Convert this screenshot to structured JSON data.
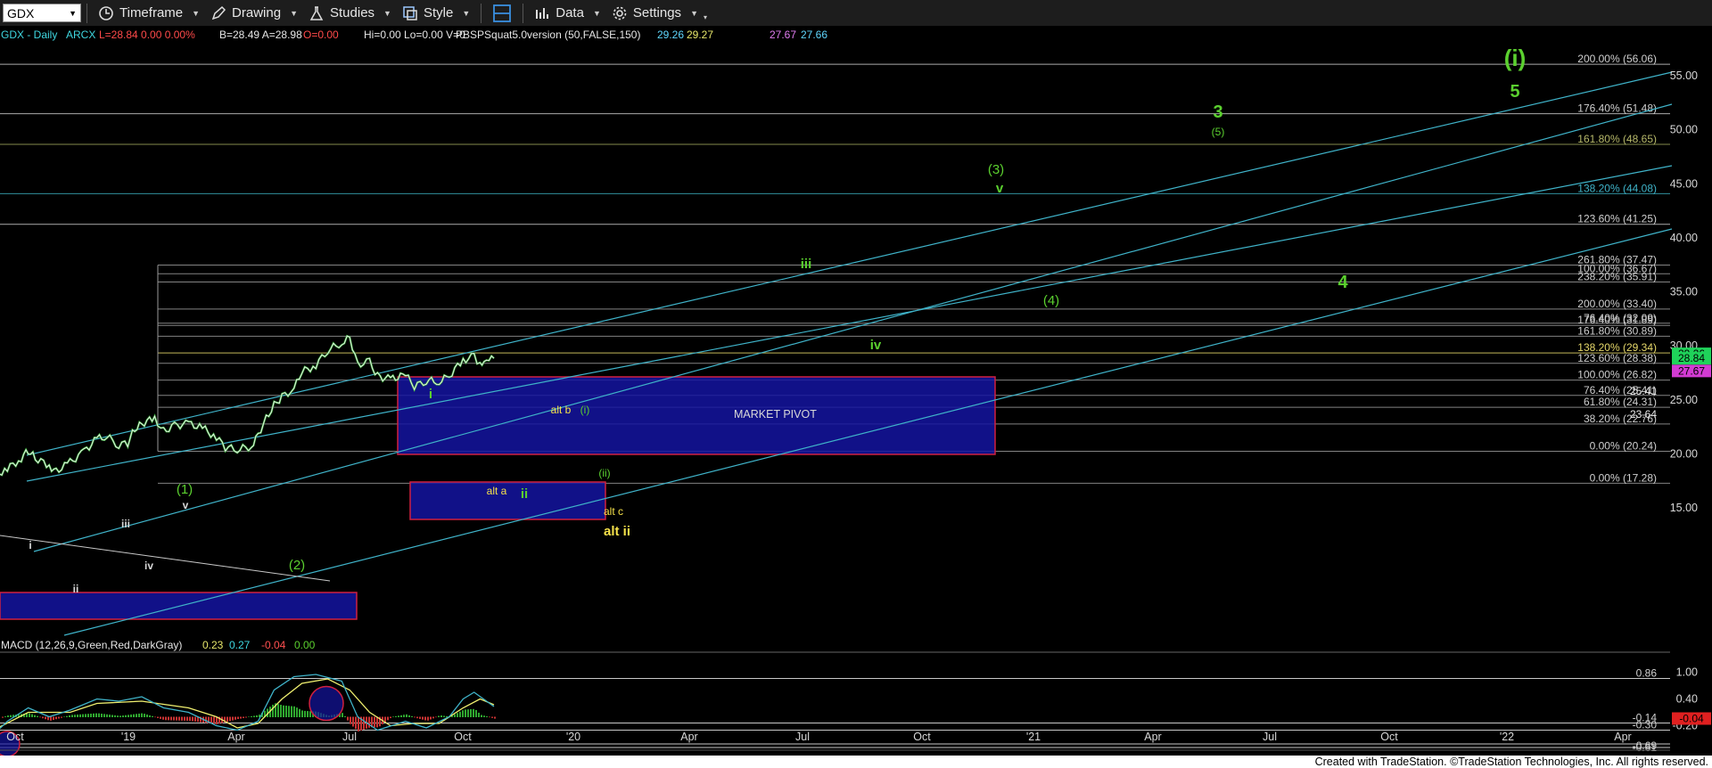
{
  "toolbar": {
    "symbol": "GDX",
    "timeframe": "Timeframe",
    "drawing": "Drawing",
    "studies": "Studies",
    "style": "Style",
    "data": "Data",
    "settings": "Settings"
  },
  "header": {
    "symbol": "GDX - Daily",
    "exchange": "ARCX",
    "quote": "L=28.84 0.00 0.00%",
    "bid_ask": "B=28.49 A=28.98",
    "ohl": "O=0.00",
    "hi": "Hi=0.00 Lo=0.00 V=0",
    "study": "PBSPSquat5.0version (50,FALSE,150)",
    "study_values": [
      "29.26",
      "29.27",
      "27.67",
      "27.66"
    ],
    "study_colors": [
      "#5fd7ff",
      "#e6e66a",
      "#e07cf0",
      "#5fd7ff"
    ]
  },
  "footer": {
    "text": "Created with TradeStation. ©TradeStation Technologies, Inc. All rights reserved."
  },
  "colors": {
    "green_label": "#5bd02f",
    "yellow_label": "#f5e14a",
    "channel": "#3fb3c9",
    "box_fill": "#1414a0",
    "box_border": "#d02040",
    "price_up": "#e8e8e8",
    "price_down": "#3ab43a",
    "macd_line": "#3fb3c9",
    "macd_signal": "#f0f070"
  },
  "chart_data": {
    "type": "line",
    "title": "GDX - Daily",
    "y_axis": {
      "ticks": [
        "55.00",
        "50.00",
        "45.00",
        "40.00",
        "35.00",
        "30.00",
        "25.00",
        "20.00",
        "15.00"
      ],
      "range": [
        13.5,
        60
      ]
    },
    "x_axis": {
      "ticks": [
        "Oct",
        "'19",
        "Apr",
        "Jul",
        "Oct",
        "'20",
        "Apr",
        "Jul",
        "Oct",
        "'21",
        "Apr",
        "Jul",
        "Oct",
        "'22",
        "Apr"
      ]
    },
    "fib_levels": [
      {
        "label": "200.00% (56.06)",
        "value": 56.06
      },
      {
        "label": "176.40% (51.48)",
        "value": 51.48
      },
      {
        "label": "161.80% (48.65)",
        "value": 48.65
      },
      {
        "label": "138.20% (44.08)",
        "value": 44.08
      },
      {
        "label": "123.60% (41.25)",
        "value": 41.25
      },
      {
        "label": "261.80% (37.47)",
        "value": 37.47
      },
      {
        "label": "100.00% (36.67)",
        "value": 36.67
      },
      {
        "label": "238.20% (35.91)",
        "value": 35.91
      },
      {
        "label": "200.00% (33.40)",
        "value": 33.4
      },
      {
        "label": "76.40% (32.09)",
        "value": 32.09
      },
      {
        "label": "176.40% (31.89)",
        "value": 31.89
      },
      {
        "label": "161.80% (30.89)",
        "value": 30.89
      },
      {
        "label": "138.20% (29.34)",
        "value": 29.34
      },
      {
        "label": "123.60% (28.38)",
        "value": 28.38
      },
      {
        "label": "100.00% (26.82)",
        "value": 26.82
      },
      {
        "label": "76.40% (25.41)",
        "value": 25.41
      },
      {
        "label": "61.80% (24.31)",
        "value": 24.31
      },
      {
        "label": "38.20% (22.76)",
        "value": 22.76
      },
      {
        "label": "0.00% (20.24)",
        "value": 20.24
      },
      {
        "label": "0.00% (17.28)",
        "value": 17.28
      }
    ],
    "extra_price_labels": [
      {
        "label": "25.41",
        "value": 25.41
      },
      {
        "label": "23.64",
        "value": 23.64
      }
    ],
    "last_price_tags": [
      {
        "label": "29.26",
        "value": 29.26,
        "color": "#1fd35a"
      },
      {
        "label": "28.84",
        "value": 28.84,
        "color": "#1fd35a"
      },
      {
        "label": "27.67",
        "value": 27.67,
        "color": "#d33bd3"
      }
    ],
    "market_pivot": {
      "label": "MARKET PIVOT"
    },
    "wave_labels": [
      {
        "text": "(i)",
        "color": "green",
        "size": "xl"
      },
      {
        "text": "5",
        "color": "green",
        "size": "l"
      },
      {
        "text": "3",
        "color": "green",
        "size": "l"
      },
      {
        "text": "(5)",
        "color": "green",
        "size": "s"
      },
      {
        "text": "(3)",
        "color": "green",
        "size": "m"
      },
      {
        "text": "v",
        "color": "green",
        "size": "m"
      },
      {
        "text": "iii",
        "color": "green",
        "size": "m"
      },
      {
        "text": "4",
        "color": "green",
        "size": "l"
      },
      {
        "text": "(4)",
        "color": "green",
        "size": "m"
      },
      {
        "text": "iv",
        "color": "green",
        "size": "m"
      },
      {
        "text": "i",
        "color": "green",
        "size": "m"
      },
      {
        "text": "alt b",
        "color": "yellow",
        "size": "s"
      },
      {
        "text": "(i)",
        "color": "green",
        "size": "s"
      },
      {
        "text": "(ii)",
        "color": "green",
        "size": "s"
      },
      {
        "text": "alt a",
        "color": "yellow",
        "size": "s"
      },
      {
        "text": "ii",
        "color": "green",
        "size": "m"
      },
      {
        "text": "alt c",
        "color": "yellow",
        "size": "s"
      },
      {
        "text": "alt ii",
        "color": "yellow",
        "size": "m"
      },
      {
        "text": "(1)",
        "color": "green",
        "size": "m"
      },
      {
        "text": "v",
        "color": "white",
        "size": "s"
      },
      {
        "text": "iii",
        "color": "white",
        "size": "s"
      },
      {
        "text": "i",
        "color": "white",
        "size": "s"
      },
      {
        "text": "iv",
        "color": "white",
        "size": "s"
      },
      {
        "text": "ii",
        "color": "white",
        "size": "s"
      },
      {
        "text": "(2)",
        "color": "green",
        "size": "m"
      }
    ],
    "price_series": [
      [
        "2018-09-11",
        18.0
      ],
      [
        "2018-09-25",
        18.6
      ],
      [
        "2018-10-09",
        19.6
      ],
      [
        "2018-10-16",
        20.3
      ],
      [
        "2018-10-23",
        19.6
      ],
      [
        "2018-11-06",
        18.9
      ],
      [
        "2018-11-13",
        18.4
      ],
      [
        "2018-11-27",
        19.2
      ],
      [
        "2018-12-11",
        20.2
      ],
      [
        "2018-12-24",
        21.4
      ],
      [
        "2019-01-03",
        21.6
      ],
      [
        "2019-01-15",
        20.8
      ],
      [
        "2019-01-24",
        21.0
      ],
      [
        "2019-01-31",
        22.3
      ],
      [
        "2019-02-07",
        22.8
      ],
      [
        "2019-02-20",
        23.3
      ],
      [
        "2019-03-01",
        22.1
      ],
      [
        "2019-03-12",
        22.6
      ],
      [
        "2019-03-26",
        22.8
      ],
      [
        "2019-04-09",
        22.4
      ],
      [
        "2019-04-23",
        21.5
      ],
      [
        "2019-05-02",
        20.6
      ],
      [
        "2019-05-14",
        20.4
      ],
      [
        "2019-05-28",
        20.7
      ],
      [
        "2019-06-04",
        21.8
      ],
      [
        "2019-06-12",
        23.3
      ],
      [
        "2019-06-20",
        24.5
      ],
      [
        "2019-06-28",
        25.3
      ],
      [
        "2019-07-10",
        26.0
      ],
      [
        "2019-07-18",
        27.6
      ],
      [
        "2019-08-01",
        28.2
      ],
      [
        "2019-08-13",
        29.6
      ],
      [
        "2019-08-27",
        30.3
      ],
      [
        "2019-09-04",
        30.8
      ],
      [
        "2019-09-12",
        28.3
      ],
      [
        "2019-09-24",
        28.5
      ],
      [
        "2019-10-02",
        27.2
      ],
      [
        "2019-10-15",
        26.9
      ],
      [
        "2019-10-30",
        27.3
      ],
      [
        "2019-11-08",
        26.2
      ],
      [
        "2019-11-20",
        26.8
      ],
      [
        "2019-12-03",
        26.7
      ],
      [
        "2019-12-13",
        27.2
      ],
      [
        "2019-12-27",
        28.7
      ],
      [
        "2020-01-07",
        29.0
      ],
      [
        "2020-01-13",
        28.1
      ],
      [
        "2020-01-17",
        28.3
      ],
      [
        "2020-01-22",
        28.6
      ],
      [
        "2020-01-27",
        28.84
      ]
    ],
    "macd": {
      "label": "MACD (12,26,9,Green,Red,DarkGray)",
      "values": [
        {
          "text": "0.23",
          "color": "#e6e66a"
        },
        {
          "text": "0.27",
          "color": "#3fd7e0"
        },
        {
          "text": "-0.04",
          "color": "#ff5050"
        },
        {
          "text": "0.00",
          "color": "#5bd02f"
        }
      ],
      "y_ticks": [
        "1.00",
        "0.40",
        "-0.20"
      ],
      "levels": [
        {
          "label": "0.86",
          "value": 0.86
        },
        {
          "label": "-0.14",
          "value": -0.14
        },
        {
          "label": "-0.30",
          "value": -0.3
        },
        {
          "label": "-0.69",
          "value": -0.69
        },
        {
          "label": "-0.61",
          "value": -0.61
        }
      ],
      "tag": {
        "label": "-0.04",
        "value": -0.04
      },
      "range": [
        -0.75,
        1.25
      ],
      "line": [
        [
          "2018-09-11",
          -0.4
        ],
        [
          "2018-09-25",
          -0.1
        ],
        [
          "2018-10-16",
          0.2
        ],
        [
          "2018-11-06",
          0.0
        ],
        [
          "2018-11-27",
          0.15
        ],
        [
          "2018-12-24",
          0.4
        ],
        [
          "2019-01-15",
          0.35
        ],
        [
          "2019-02-07",
          0.45
        ],
        [
          "2019-03-01",
          0.2
        ],
        [
          "2019-03-26",
          0.1
        ],
        [
          "2019-04-23",
          -0.2
        ],
        [
          "2019-05-14",
          -0.3
        ],
        [
          "2019-06-04",
          -0.1
        ],
        [
          "2019-06-20",
          0.6
        ],
        [
          "2019-07-10",
          0.9
        ],
        [
          "2019-08-01",
          0.95
        ],
        [
          "2019-08-27",
          0.8
        ],
        [
          "2019-09-12",
          0.0
        ],
        [
          "2019-10-02",
          -0.3
        ],
        [
          "2019-10-30",
          -0.1
        ],
        [
          "2019-11-20",
          -0.25
        ],
        [
          "2019-12-13",
          0.0
        ],
        [
          "2019-12-27",
          0.4
        ],
        [
          "2020-01-07",
          0.55
        ],
        [
          "2020-01-27",
          0.23
        ]
      ],
      "signal": [
        [
          "2018-09-11",
          -0.3
        ],
        [
          "2018-10-16",
          0.1
        ],
        [
          "2018-11-27",
          0.1
        ],
        [
          "2018-12-24",
          0.3
        ],
        [
          "2019-02-07",
          0.35
        ],
        [
          "2019-03-26",
          0.2
        ],
        [
          "2019-04-23",
          0.0
        ],
        [
          "2019-05-14",
          -0.25
        ],
        [
          "2019-06-04",
          -0.15
        ],
        [
          "2019-06-28",
          0.4
        ],
        [
          "2019-07-18",
          0.75
        ],
        [
          "2019-08-13",
          0.85
        ],
        [
          "2019-09-04",
          0.6
        ],
        [
          "2019-09-24",
          0.1
        ],
        [
          "2019-10-15",
          -0.2
        ],
        [
          "2019-11-08",
          -0.15
        ],
        [
          "2019-12-03",
          -0.15
        ],
        [
          "2019-12-27",
          0.2
        ],
        [
          "2020-01-13",
          0.4
        ],
        [
          "2020-01-27",
          0.27
        ]
      ]
    }
  }
}
